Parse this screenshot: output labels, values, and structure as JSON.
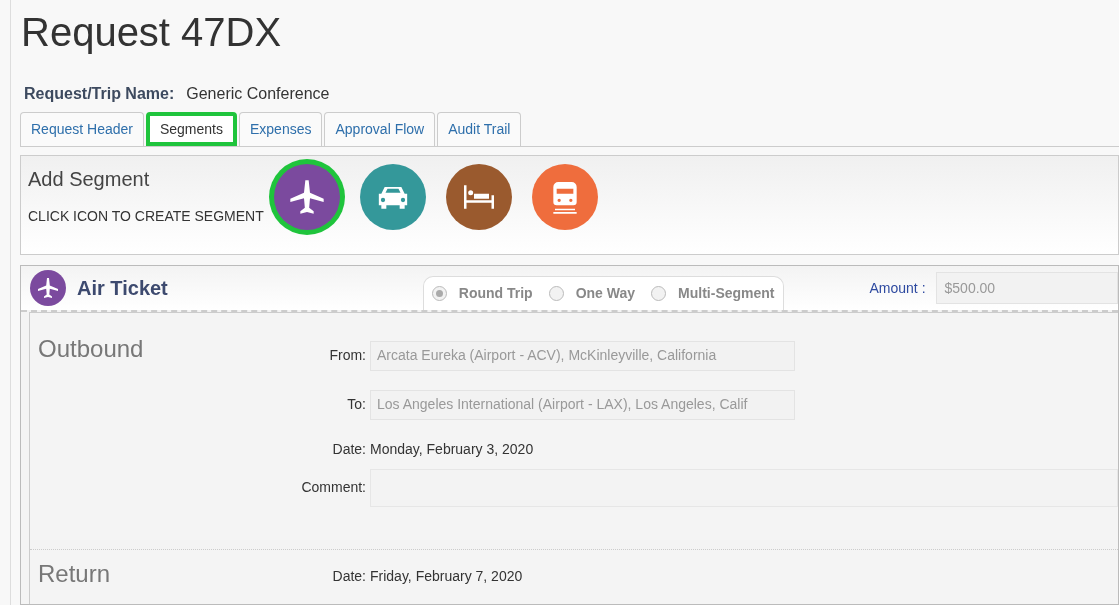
{
  "title": "Request 47DX",
  "trip_name": {
    "label": "Request/Trip Name:",
    "value": "Generic Conference"
  },
  "tabs": [
    {
      "label": "Request Header",
      "selected": false,
      "highlighted": false
    },
    {
      "label": "Segments",
      "selected": true,
      "highlighted": true
    },
    {
      "label": "Expenses",
      "selected": false,
      "highlighted": false
    },
    {
      "label": "Approval Flow",
      "selected": false,
      "highlighted": false
    },
    {
      "label": "Audit Trail",
      "selected": false,
      "highlighted": false
    }
  ],
  "add_segment": {
    "title": "Add Segment",
    "hint": "CLICK ICON TO CREATE SEGMENT",
    "icons": [
      {
        "kind": "air",
        "color": "#7b4a9e",
        "highlighted": true
      },
      {
        "kind": "car",
        "color": "#34989a",
        "highlighted": false
      },
      {
        "kind": "hotel",
        "color": "#9a5a2e",
        "highlighted": false
      },
      {
        "kind": "rail",
        "color": "#ef6d3d",
        "highlighted": false
      }
    ]
  },
  "segment": {
    "kind": "air",
    "title": "Air Ticket",
    "trip_types": [
      {
        "label": "Round Trip",
        "selected": true
      },
      {
        "label": "One Way",
        "selected": false
      },
      {
        "label": "Multi-Segment",
        "selected": false
      }
    ],
    "amount": {
      "label": "Amount :",
      "value": "$500.00"
    },
    "sections": [
      {
        "title": "Outbound",
        "fields": [
          {
            "kind": "input",
            "label": "From:",
            "value": "Arcata Eureka (Airport - ACV), McKinleyville, California"
          },
          {
            "kind": "input",
            "label": "To:",
            "value": "Los Angeles International (Airport - LAX), Los Angeles, Calif"
          },
          {
            "kind": "text",
            "label": "Date:",
            "value": "Monday, February 3, 2020"
          },
          {
            "kind": "textarea",
            "label": "Comment:"
          }
        ]
      },
      {
        "title": "Return",
        "fields": [
          {
            "kind": "text",
            "label": "Date:",
            "value": "Friday, February 7, 2020"
          }
        ]
      }
    ]
  }
}
